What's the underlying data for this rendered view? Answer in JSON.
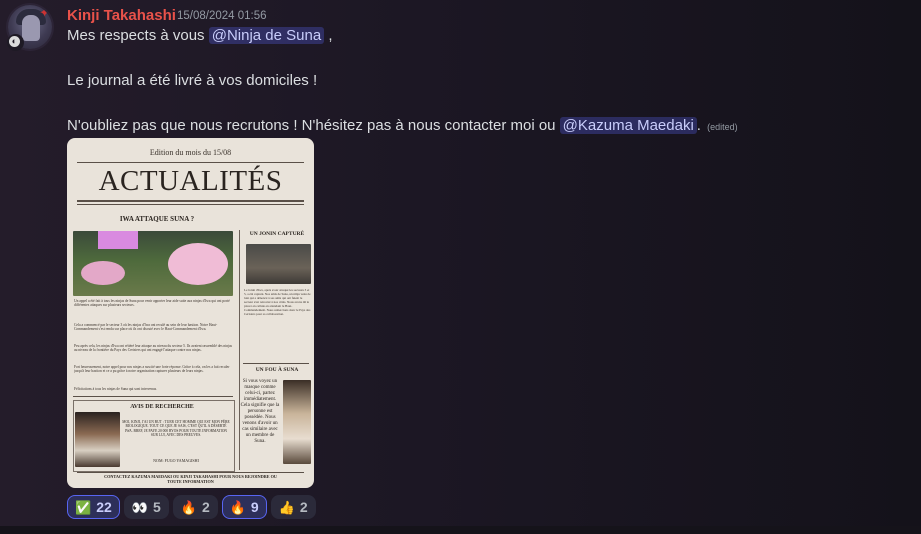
{
  "message": {
    "author": "Kinji Takahashi",
    "timestamp": "15/08/2024 01:56",
    "line1_text": "Mes respects à vous ",
    "line1_mention": "@Ninja de Suna",
    "line1_suffix": " ,",
    "line2": "Le journal a été livré à vos domiciles !",
    "line3_text": "N'oubliez pas que nous recrutons ! N'hésitez pas à nous contacter moi ou ",
    "line3_mention": "@Kazuma Maedaki",
    "line3_suffix": ".",
    "edited": "(edited)",
    "author_color": "#e9524a"
  },
  "newspaper": {
    "edition": "Edition du mois du 15/08",
    "title": "ACTUALITÉS",
    "main_headline": "IWA ATTAQUE SUNA ?",
    "main_text_1": "Un appel a été fait à tous les ninjas de Suna pour venir apporter leur aide suite aux ninjas d'Iwa qui ont porté différentes attaques sur plusieurs secteurs.",
    "main_text_2": "Cela a commencé par le secteur 3 où les ninjas d'Iwa ont reculé au sein de leur bastion. Notre Haut-Commandement s'est rendu sur place où ils ont discuté avec le Haut-Commandement d'Iwa.",
    "main_text_3": "Peu après cela, les ninjas d'Iwa ont réitéré leur attaque au niveau du secteur 5. Ils avaient rassemblé des ninjas au niveau de la frontière du Pays des Cerisiers qui ont engagé l'attaque contre nos ninjas.",
    "main_text_4": "Fort heureusement, notre appel pour nos ninjas a suscité une forte réponse. Grâce à cela, on les a fait reculer jusqu'à leur bastion et ce a pu grâce à notre organisation capturer plusieurs de leurs ninjas.",
    "main_text_5": "Félicitations à tous les ninjas de Suna qui sont intervenus.",
    "side_headline_1": "UN JONIN CAPTURÉ",
    "side_text_1": "Le Jonin d'Iwa, après avoir attaqué les secteurs 3 et 5, a été capturé. Nos amis de Suna, un ninja venu de loin qui a dénoncé à ses amis qui ont fuient le secteur s'est retrouvé à nos côtés. Nous avons dû le placer en cellule en attendant le Haut-Commandement. Nous remercions donc le Pays des Cerisiers pour sa collaboration.",
    "side_headline_2": "UN FOU À SUNA",
    "side_text_2": "Si vous voyez un masque comme celui-ci, partez immédiatement. Cela signifie que la personne est possédée. Nous venons d'avoir un cas similaire avec un membre de Suna.",
    "wanted_headline": "AVIS DE RECHERCHE",
    "wanted_text": "MOI, KINJI, J'AI UN BUT : TUER CET HOMME QUI EST MON PÈRE BIOLOGIQUE. TOUT CE QUE JE SAIS, C'EST QU'IL A DÉSERTÉ IWA. BREF, JE PAYE 20 000 RYOS POUR TOUTE INFORMATION SUR LUI, AVEC DES PREUVES.",
    "wanted_name": "NOM: FUGO YAMAGISHI",
    "footer": "CONTACTEZ KAZUMA MAEDAKI OU KINJI TAKAHASHI POUR NOUS REJOINDRE OU TOUTE INFORMATION"
  },
  "reactions": [
    {
      "emoji": "✅",
      "count": "22",
      "active": true
    },
    {
      "emoji": "👀",
      "count": "5",
      "active": false
    },
    {
      "emoji": "🔥",
      "count": "2",
      "active": false
    },
    {
      "emoji": "🔥",
      "count": "9",
      "active": true
    },
    {
      "emoji": "👍",
      "count": "2",
      "active": false
    }
  ],
  "colors": {
    "background": "#1c1724",
    "mention_bg": "#3b3f7a",
    "reaction_active_border": "#5865f2"
  }
}
